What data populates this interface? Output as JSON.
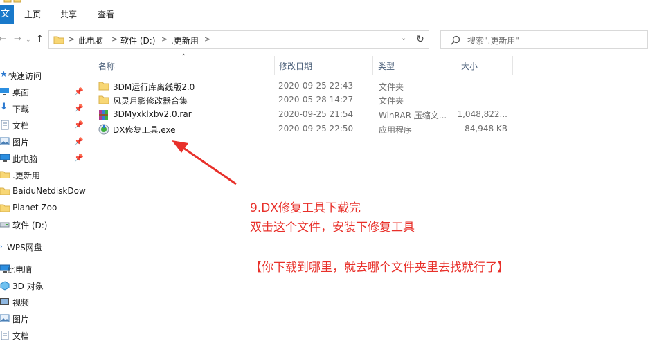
{
  "ribbon": {
    "file_tab": "文件",
    "tabs": [
      "主页",
      "共享",
      "查看"
    ]
  },
  "address": {
    "crumbs": [
      "此电脑",
      "软件 (D:)",
      ".更新用"
    ],
    "search_placeholder": "搜索\".更新用\""
  },
  "sidebar": {
    "items": [
      {
        "label": "快速访问",
        "icon": "star-icon",
        "pinned": false
      },
      {
        "label": "桌面",
        "icon": "desktop-icon",
        "pinned": true
      },
      {
        "label": "下载",
        "icon": "download-icon",
        "pinned": true
      },
      {
        "label": "文档",
        "icon": "document-icon",
        "pinned": true
      },
      {
        "label": "图片",
        "icon": "picture-icon",
        "pinned": true
      },
      {
        "label": "此电脑",
        "icon": "computer-icon",
        "pinned": true
      },
      {
        "label": ".更新用",
        "icon": "folder-icon",
        "pinned": false
      },
      {
        "label": "BaiduNetdiskDow",
        "icon": "folder-icon",
        "pinned": false
      },
      {
        "label": "Planet Zoo",
        "icon": "folder-icon",
        "pinned": false
      },
      {
        "label": "软件 (D:)",
        "icon": "drive-icon",
        "pinned": false
      },
      {
        "label": "WPS网盘",
        "icon": "cloud-icon",
        "pinned": false
      },
      {
        "label": "此电脑",
        "icon": "computer-icon",
        "pinned": false
      },
      {
        "label": "3D 对象",
        "icon": "cube-icon",
        "pinned": false
      },
      {
        "label": "视频",
        "icon": "video-icon",
        "pinned": false
      },
      {
        "label": "图片",
        "icon": "picture-icon",
        "pinned": false
      },
      {
        "label": "文档",
        "icon": "document-icon",
        "pinned": false
      }
    ]
  },
  "columns": {
    "name": "名称",
    "date": "修改日期",
    "type": "类型",
    "size": "大小"
  },
  "files": [
    {
      "name": "3DM运行库离线版2.0",
      "date": "2020-09-25 22:43",
      "type": "文件夹",
      "size": "",
      "icon": "folder-icon"
    },
    {
      "name": "风灵月影修改器合集",
      "date": "2020-05-28 14:27",
      "type": "文件夹",
      "size": "",
      "icon": "folder-icon"
    },
    {
      "name": "3DMyxklxbv2.0.rar",
      "date": "2020-09-25 21:54",
      "type": "WinRAR 压缩文...",
      "size": "1,048,822...",
      "icon": "winrar-archive-icon"
    },
    {
      "name": "DX修复工具.exe",
      "date": "2020-09-25 22:50",
      "type": "应用程序",
      "size": "84,948 KB",
      "icon": "dx-repair-exe-icon"
    }
  ],
  "annotation": {
    "line1": "9.DX修复工具下载完",
    "line2": "双击这个文件，安装下修复工具",
    "line3": "【你下载到哪里，就去哪个文件夹里去找就行了】",
    "color": "#e8302a"
  },
  "colors": {
    "accent": "#1979ca",
    "folder": "#f8d775",
    "header_text": "#4c607a"
  }
}
